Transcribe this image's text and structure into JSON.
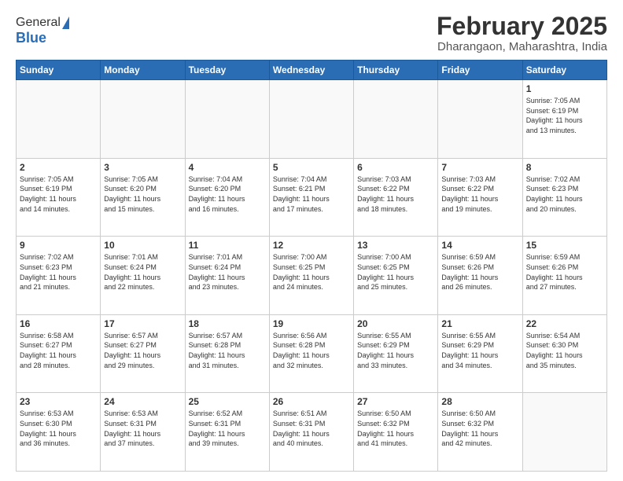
{
  "header": {
    "logo": {
      "general": "General",
      "blue": "Blue",
      "icon": "▶"
    },
    "title": "February 2025",
    "location": "Dharangaon, Maharashtra, India"
  },
  "days_of_week": [
    "Sunday",
    "Monday",
    "Tuesday",
    "Wednesday",
    "Thursday",
    "Friday",
    "Saturday"
  ],
  "weeks": [
    [
      {
        "day": "",
        "info": ""
      },
      {
        "day": "",
        "info": ""
      },
      {
        "day": "",
        "info": ""
      },
      {
        "day": "",
        "info": ""
      },
      {
        "day": "",
        "info": ""
      },
      {
        "day": "",
        "info": ""
      },
      {
        "day": "1",
        "info": "Sunrise: 7:05 AM\nSunset: 6:19 PM\nDaylight: 11 hours\nand 13 minutes."
      }
    ],
    [
      {
        "day": "2",
        "info": "Sunrise: 7:05 AM\nSunset: 6:19 PM\nDaylight: 11 hours\nand 14 minutes."
      },
      {
        "day": "3",
        "info": "Sunrise: 7:05 AM\nSunset: 6:20 PM\nDaylight: 11 hours\nand 15 minutes."
      },
      {
        "day": "4",
        "info": "Sunrise: 7:04 AM\nSunset: 6:20 PM\nDaylight: 11 hours\nand 16 minutes."
      },
      {
        "day": "5",
        "info": "Sunrise: 7:04 AM\nSunset: 6:21 PM\nDaylight: 11 hours\nand 17 minutes."
      },
      {
        "day": "6",
        "info": "Sunrise: 7:03 AM\nSunset: 6:22 PM\nDaylight: 11 hours\nand 18 minutes."
      },
      {
        "day": "7",
        "info": "Sunrise: 7:03 AM\nSunset: 6:22 PM\nDaylight: 11 hours\nand 19 minutes."
      },
      {
        "day": "8",
        "info": "Sunrise: 7:02 AM\nSunset: 6:23 PM\nDaylight: 11 hours\nand 20 minutes."
      }
    ],
    [
      {
        "day": "9",
        "info": "Sunrise: 7:02 AM\nSunset: 6:23 PM\nDaylight: 11 hours\nand 21 minutes."
      },
      {
        "day": "10",
        "info": "Sunrise: 7:01 AM\nSunset: 6:24 PM\nDaylight: 11 hours\nand 22 minutes."
      },
      {
        "day": "11",
        "info": "Sunrise: 7:01 AM\nSunset: 6:24 PM\nDaylight: 11 hours\nand 23 minutes."
      },
      {
        "day": "12",
        "info": "Sunrise: 7:00 AM\nSunset: 6:25 PM\nDaylight: 11 hours\nand 24 minutes."
      },
      {
        "day": "13",
        "info": "Sunrise: 7:00 AM\nSunset: 6:25 PM\nDaylight: 11 hours\nand 25 minutes."
      },
      {
        "day": "14",
        "info": "Sunrise: 6:59 AM\nSunset: 6:26 PM\nDaylight: 11 hours\nand 26 minutes."
      },
      {
        "day": "15",
        "info": "Sunrise: 6:59 AM\nSunset: 6:26 PM\nDaylight: 11 hours\nand 27 minutes."
      }
    ],
    [
      {
        "day": "16",
        "info": "Sunrise: 6:58 AM\nSunset: 6:27 PM\nDaylight: 11 hours\nand 28 minutes."
      },
      {
        "day": "17",
        "info": "Sunrise: 6:57 AM\nSunset: 6:27 PM\nDaylight: 11 hours\nand 29 minutes."
      },
      {
        "day": "18",
        "info": "Sunrise: 6:57 AM\nSunset: 6:28 PM\nDaylight: 11 hours\nand 31 minutes."
      },
      {
        "day": "19",
        "info": "Sunrise: 6:56 AM\nSunset: 6:28 PM\nDaylight: 11 hours\nand 32 minutes."
      },
      {
        "day": "20",
        "info": "Sunrise: 6:55 AM\nSunset: 6:29 PM\nDaylight: 11 hours\nand 33 minutes."
      },
      {
        "day": "21",
        "info": "Sunrise: 6:55 AM\nSunset: 6:29 PM\nDaylight: 11 hours\nand 34 minutes."
      },
      {
        "day": "22",
        "info": "Sunrise: 6:54 AM\nSunset: 6:30 PM\nDaylight: 11 hours\nand 35 minutes."
      }
    ],
    [
      {
        "day": "23",
        "info": "Sunrise: 6:53 AM\nSunset: 6:30 PM\nDaylight: 11 hours\nand 36 minutes."
      },
      {
        "day": "24",
        "info": "Sunrise: 6:53 AM\nSunset: 6:31 PM\nDaylight: 11 hours\nand 37 minutes."
      },
      {
        "day": "25",
        "info": "Sunrise: 6:52 AM\nSunset: 6:31 PM\nDaylight: 11 hours\nand 39 minutes."
      },
      {
        "day": "26",
        "info": "Sunrise: 6:51 AM\nSunset: 6:31 PM\nDaylight: 11 hours\nand 40 minutes."
      },
      {
        "day": "27",
        "info": "Sunrise: 6:50 AM\nSunset: 6:32 PM\nDaylight: 11 hours\nand 41 minutes."
      },
      {
        "day": "28",
        "info": "Sunrise: 6:50 AM\nSunset: 6:32 PM\nDaylight: 11 hours\nand 42 minutes."
      },
      {
        "day": "",
        "info": ""
      }
    ]
  ]
}
